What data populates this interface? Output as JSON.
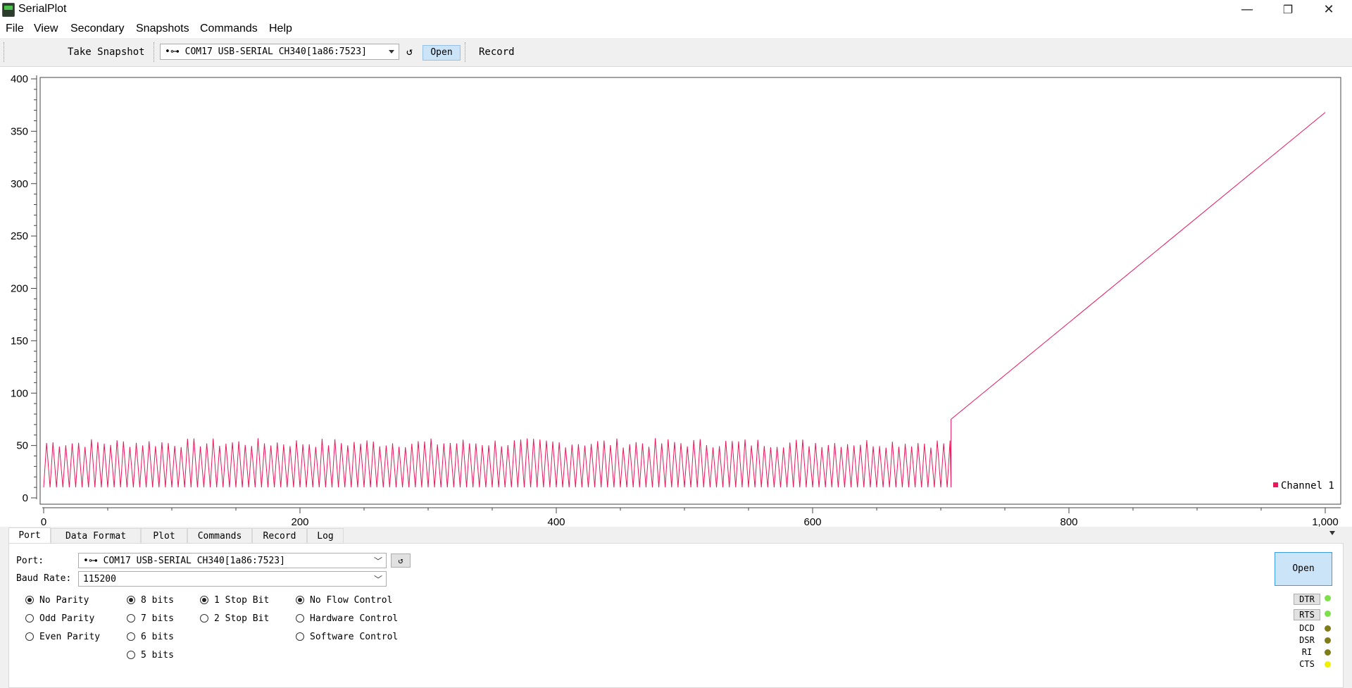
{
  "window": {
    "title": "SerialPlot",
    "minimize": "—",
    "restore": "❐",
    "close": "✕"
  },
  "menu": [
    "File",
    "View",
    "Secondary",
    "Snapshots",
    "Commands",
    "Help"
  ],
  "toolbar": {
    "snapshot_label": "Take Snapshot",
    "port_value": "•⊶ COM17 USB-SERIAL CH340[1a86:7523]",
    "refresh_icon": "↺",
    "open_label": "Open",
    "record_label": "Record"
  },
  "chart_data": {
    "type": "line",
    "xlim": [
      0,
      1000
    ],
    "ylim": [
      0,
      400
    ],
    "x_ticks": [
      "0",
      "200",
      "400",
      "600",
      "800",
      "1,000"
    ],
    "y_ticks": [
      "0",
      "50",
      "100",
      "150",
      "200",
      "250",
      "300",
      "350",
      "400"
    ],
    "grid": false,
    "legend_position": "bottom-right",
    "series": [
      {
        "name": "Channel 1",
        "color": "#e8185a",
        "description_of_shape": "oscillation between ~10 and ~55 with period ~5 from x=0 to x=708, then linear ramp",
        "oscillation": {
          "x_start": 0,
          "x_end": 708,
          "low": 10,
          "high_min": 48,
          "high_max": 57,
          "period": 5
        },
        "ramp": {
          "x_start": 708,
          "x_end": 1000,
          "y_start": 75,
          "y_end": 368
        }
      }
    ]
  },
  "tabs": [
    "Port",
    "Data Format",
    "Plot",
    "Commands",
    "Record",
    "Log"
  ],
  "active_tab": "Port",
  "port_panel": {
    "port_label": "Port:",
    "port_value": "•⊶ COM17 USB-SERIAL CH340[1a86:7523]",
    "refresh_icon": "↺",
    "baud_label": "Baud Rate:",
    "baud_value": "115200",
    "parity": [
      {
        "label": "No Parity",
        "checked": true
      },
      {
        "label": "Odd Parity",
        "checked": false
      },
      {
        "label": "Even Parity",
        "checked": false
      }
    ],
    "data_bits": [
      {
        "label": "8 bits",
        "checked": true
      },
      {
        "label": "7 bits",
        "checked": false
      },
      {
        "label": "6 bits",
        "checked": false
      },
      {
        "label": "5 bits",
        "checked": false
      }
    ],
    "stop_bits": [
      {
        "label": "1 Stop Bit",
        "checked": true
      },
      {
        "label": "2 Stop Bit",
        "checked": false
      }
    ],
    "flow_control": [
      {
        "label": "No Flow Control",
        "checked": true
      },
      {
        "label": "Hardware Control",
        "checked": false
      },
      {
        "label": "Software Control",
        "checked": false
      }
    ],
    "open_label": "Open",
    "signals": {
      "dtr": {
        "label": "DTR",
        "color": "#7be04a"
      },
      "rts": {
        "label": "RTS",
        "color": "#7be04a"
      },
      "dcd": {
        "label": "DCD",
        "color": "#807d18"
      },
      "dsr": {
        "label": "DSR",
        "color": "#807d18"
      },
      "ri": {
        "label": "RI",
        "color": "#807d18"
      },
      "cts": {
        "label": "CTS",
        "color": "#f0f000"
      }
    }
  }
}
